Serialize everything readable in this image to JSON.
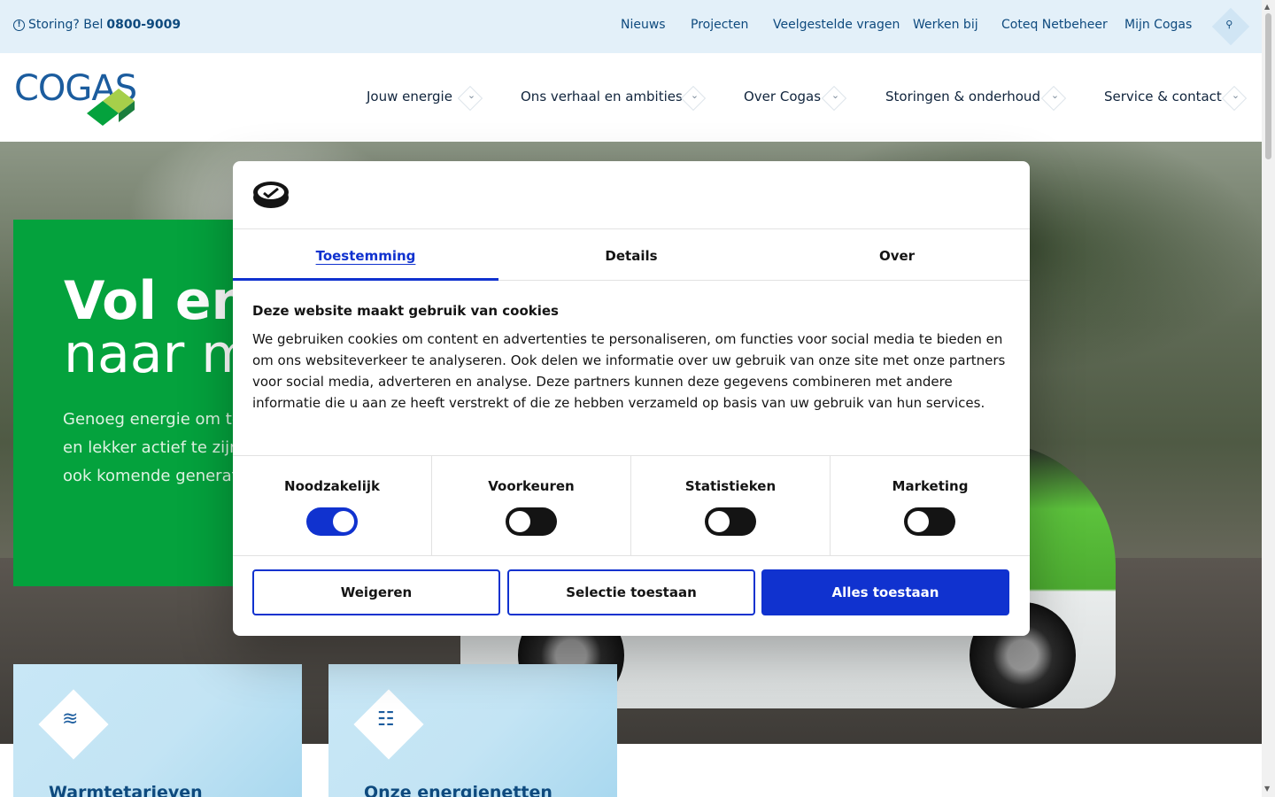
{
  "topbar": {
    "storing_prefix": "Storing? Bel",
    "storing_phone": "0800-9009",
    "links": [
      "Nieuws",
      "Projecten",
      "Veelgestelde vragen",
      "Werken bij",
      "Coteq Netbeheer",
      "Mijn Cogas"
    ]
  },
  "header": {
    "logo_text": "COGAS",
    "nav": [
      "Jouw energie",
      "Ons verhaal en ambities",
      "Over Cogas",
      "Storingen & onderhoud",
      "Service & contact"
    ]
  },
  "hero": {
    "title": "Vol energie",
    "subtitle": "naar morgen",
    "text_lines": [
      "Genoeg energie om te",
      "en lekker actief te zijn",
      "ook komende generaties"
    ]
  },
  "cards": [
    {
      "title": "Warmtetarieven",
      "icon": "heat-waves-icon"
    },
    {
      "title": "Onze energienetten",
      "icon": "network-icon"
    }
  ],
  "cookie_dialog": {
    "tabs": [
      "Toestemming",
      "Details",
      "Over"
    ],
    "active_tab": "Toestemming",
    "heading": "Deze website maakt gebruik van cookies",
    "body": "We gebruiken cookies om content en advertenties te personaliseren, om functies voor social media te bieden en om ons websiteverkeer te analyseren. Ook delen we informatie over uw gebruik van onze site met onze partners voor social media, adverteren en analyse. Deze partners kunnen deze gegevens combineren met andere informatie die u aan ze heeft verstrekt of die ze hebben verzameld op basis van uw gebruik van hun services.",
    "toggles": [
      {
        "label": "Noodzakelijk",
        "on": true
      },
      {
        "label": "Voorkeuren",
        "on": false
      },
      {
        "label": "Statistieken",
        "on": false
      },
      {
        "label": "Marketing",
        "on": false
      }
    ],
    "buttons": {
      "reject": "Weigeren",
      "allow_selection": "Selectie toestaan",
      "allow_all": "Alles toestaan"
    }
  },
  "colors": {
    "topbar_bg": "#e3f0f9",
    "brand_blue": "#0e4a7e",
    "brand_green": "#04a23d",
    "cookiebot_blue": "#1032cf"
  }
}
